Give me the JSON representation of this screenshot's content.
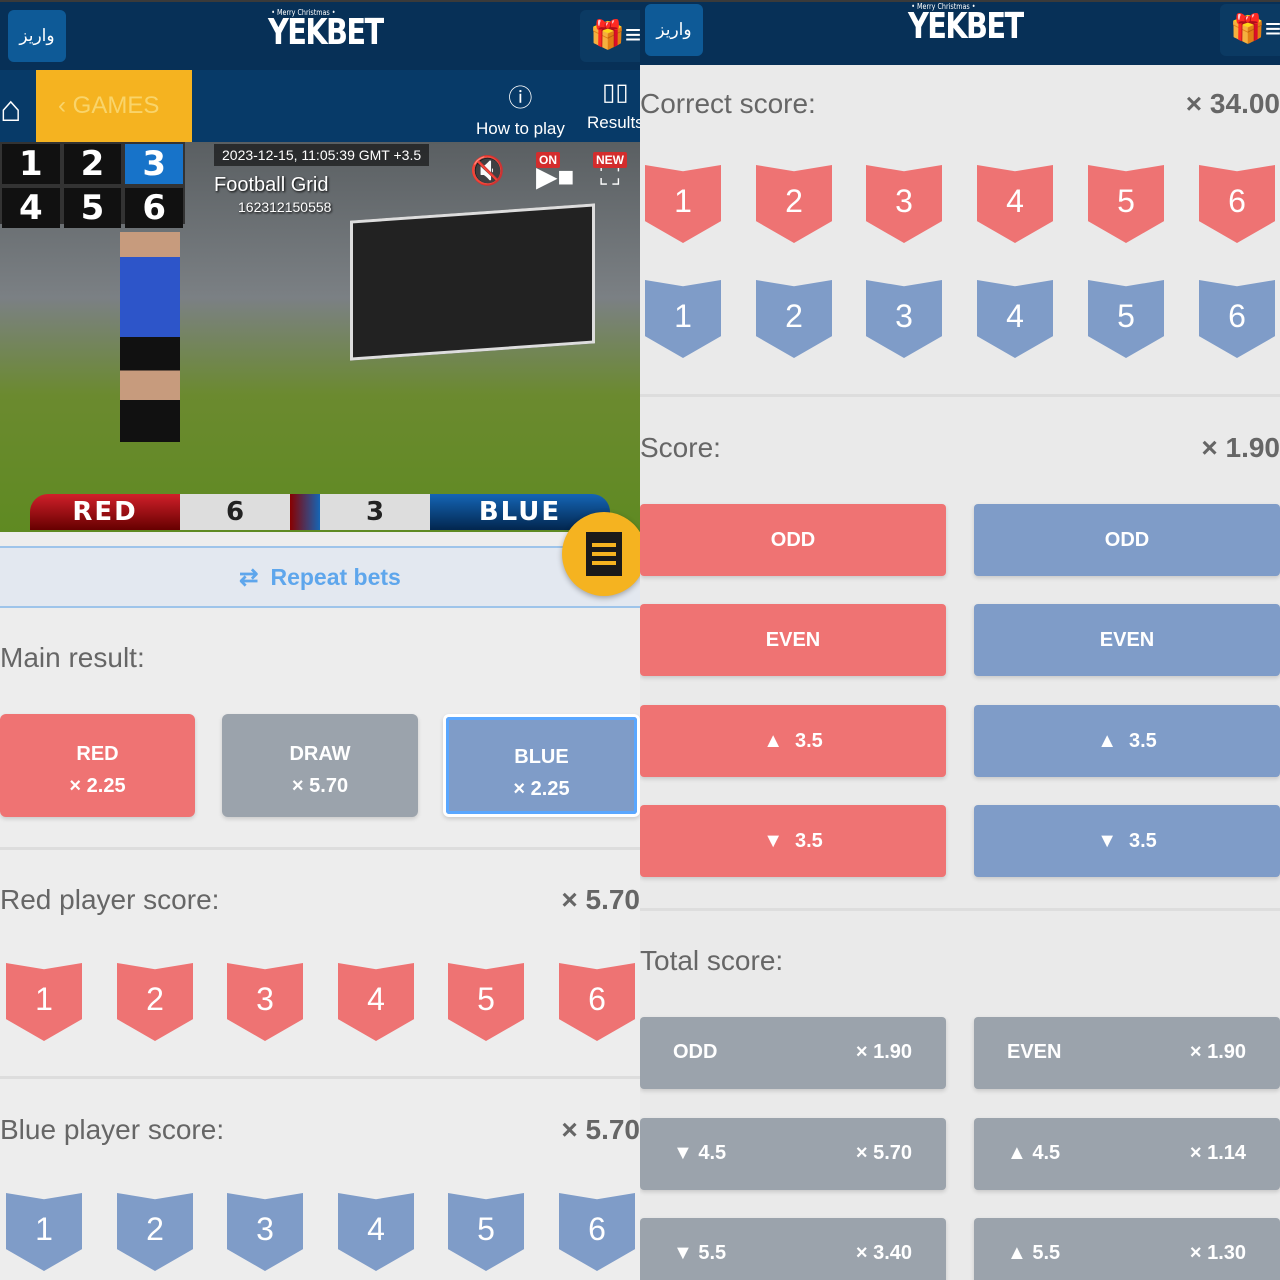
{
  "header": {
    "deposit_label": "واریز",
    "logo_text": "YEKBET",
    "logo_sub": "• Merry Christmas •",
    "gift_icon": "gift-icon",
    "menu_icon": "menu-icon"
  },
  "nav": {
    "games_label": "GAMES",
    "how_to_play": "How to play",
    "results": "Results"
  },
  "video": {
    "grid": [
      "1",
      "2",
      "3",
      "4",
      "5",
      "6"
    ],
    "active_cell": "3",
    "timestamp": "2023-12-15, 11:05:39 GMT +3.5",
    "game_name": "Football Grid",
    "game_id": "162312150558",
    "on_badge": "ON",
    "new_badge": "NEW",
    "red_label": "RED",
    "red_score": "6",
    "blue_score": "3",
    "blue_label": "BLUE"
  },
  "repeat_bets": "Repeat bets",
  "main_result": {
    "label": "Main result:",
    "options": [
      {
        "name": "RED",
        "odds": "× 2.25"
      },
      {
        "name": "DRAW",
        "odds": "× 5.70"
      },
      {
        "name": "BLUE",
        "odds": "× 2.25",
        "selected": true
      }
    ]
  },
  "red_player": {
    "label": "Red player score:",
    "odds": "× 5.70",
    "scores": [
      "1",
      "2",
      "3",
      "4",
      "5",
      "6"
    ]
  },
  "blue_player": {
    "label": "Blue player score:",
    "odds": "× 5.70",
    "scores": [
      "1",
      "2",
      "3",
      "4",
      "5",
      "6"
    ]
  },
  "correct_score": {
    "label": "Correct score:",
    "odds": "× 34.00",
    "red": [
      "1",
      "2",
      "3",
      "4",
      "5",
      "6"
    ],
    "blue": [
      "1",
      "2",
      "3",
      "4",
      "5",
      "6"
    ]
  },
  "score": {
    "label": "Score:",
    "odds": "× 1.90",
    "red": [
      {
        "icon": "",
        "text": "ODD"
      },
      {
        "icon": "",
        "text": "EVEN"
      },
      {
        "icon": "▲",
        "text": "3.5"
      },
      {
        "icon": "▼",
        "text": "3.5"
      }
    ],
    "blue": [
      {
        "icon": "",
        "text": "ODD"
      },
      {
        "icon": "",
        "text": "EVEN"
      },
      {
        "icon": "▲",
        "text": "3.5"
      },
      {
        "icon": "▼",
        "text": "3.5"
      }
    ]
  },
  "total_score": {
    "label": "Total score:",
    "rows": [
      [
        {
          "text": "ODD",
          "odds": "× 1.90"
        },
        {
          "text": "EVEN",
          "odds": "× 1.90"
        }
      ],
      [
        {
          "text": "▼  4.5",
          "odds": "× 5.70"
        },
        {
          "text": "▲  4.5",
          "odds": "× 1.14"
        }
      ],
      [
        {
          "text": "▼  5.5",
          "odds": "× 3.40"
        },
        {
          "text": "▲  5.5",
          "odds": "× 1.30"
        }
      ]
    ]
  },
  "colors": {
    "header": "#073057",
    "accent_yellow": "#f5b320",
    "red": "#ef7373",
    "blue": "#7f9cc8",
    "gray": "#9ba3ac"
  }
}
